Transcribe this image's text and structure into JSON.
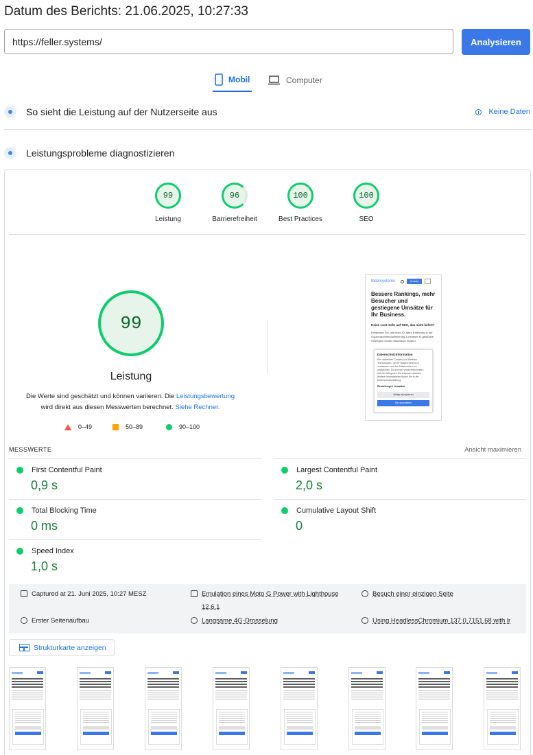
{
  "report": {
    "date_label": "Datum des Berichts: 21.06.2025, 10:27:33"
  },
  "search": {
    "url_value": "https://feller.systems/",
    "analyze_label": "Analysieren"
  },
  "tabs": [
    {
      "label": "Mobil",
      "icon": "smartphone-icon",
      "active": true
    },
    {
      "label": "Computer",
      "icon": "laptop-icon",
      "active": false
    }
  ],
  "field_section": {
    "title": "So sieht die Leistung auf der Nutzerseite aus",
    "no_data": "Keine Daten"
  },
  "lab_section": {
    "title": "Leistungsprobleme diagnostizieren"
  },
  "scores": [
    {
      "value": "99",
      "label": "Leistung"
    },
    {
      "value": "96",
      "label": "Barrierefreiheit"
    },
    {
      "value": "100",
      "label": "Best Practices"
    },
    {
      "value": "100",
      "label": "SEO"
    }
  ],
  "main_score": {
    "value": "99",
    "label": "Leistung",
    "desc_1": "Die Werte sind geschätzt und können variieren. Die ",
    "desc_link_1": "Leistungsbewertung",
    "desc_2": "wird direkt aus diesen Messwerten berechnet. ",
    "desc_link_2": "Siehe Rechner."
  },
  "legend": {
    "low": "0–49",
    "mid": "50–89",
    "high": "90–100"
  },
  "colors": {
    "pass": "#0cce6b",
    "average": "#ffa400",
    "fail": "#ff4e42",
    "accent": "#1a73e8"
  },
  "preview": {
    "brand": "fellersystems",
    "cta": "Kontakt",
    "headline": "Bessere Rankings, mehr Besucher und gestiegene Umsätze für Ihr Business.",
    "question": "Keine Lust mehr auf SEO, das nicht liefert?",
    "paragraph": "Entdecken Sie, wie über 30 Jahre Erfahrung in der Suchmaschinenoptimierung & neueste KI-gestützte Strategien echtes Wachstum fördern.",
    "dialog_title": "Datenschutzinformation",
    "dialog_text": "Wir verwenden Cookies und ähnliche Technologien, um Ihr Nutzererlebnis zu verbessern und den Datenverkehr zu analysieren. Sie können selbst entscheiden, welche Kategorien Sie zulassen möchten. Weitere Informationen finden Sie in der Datenschutzerklärung.",
    "dialog_settings": "Einstellungen verwalten",
    "dialog_btn_1": "Nötige akzeptieren",
    "dialog_btn_2": "Alle akzeptieren"
  },
  "metrics": {
    "heading": "MESSWERTE",
    "expand": "Ansicht maximieren",
    "items": [
      {
        "name": "First Contentful Paint",
        "value": "0,9 s"
      },
      {
        "name": "Largest Contentful Paint",
        "value": "2,0 s"
      },
      {
        "name": "Total Blocking Time",
        "value": "0 ms"
      },
      {
        "name": "Cumulative Layout Shift",
        "value": "0"
      },
      {
        "name": "Speed Index",
        "value": "1,0 s"
      }
    ]
  },
  "run_info": {
    "captured": "Captured at 21. Juni 2025, 10:27 MESZ",
    "emulation": "Emulation eines Moto G Power with Lighthouse 12.6.1",
    "session": "Besuch einer einzigen Seite",
    "load": "Erster Seitenaufbau",
    "throttling": "Langsame 4G-Drosselung",
    "browser": "Using HeadlessChromium 137.0.7151.68 with lr"
  },
  "treemap": {
    "label": "Strukturkarte anzeigen"
  }
}
